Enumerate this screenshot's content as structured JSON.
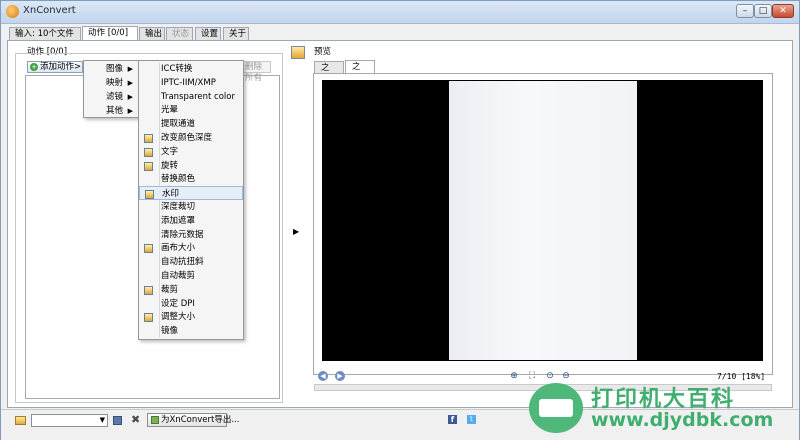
{
  "window": {
    "title": "XnConvert",
    "controls": {
      "minimize": "–",
      "maximize": "□",
      "close": "✕"
    }
  },
  "tabs": [
    {
      "label": "输入: 10个文件",
      "state": "normal"
    },
    {
      "label": "动作 [0/0]",
      "state": "active"
    },
    {
      "label": "输出",
      "state": "normal"
    },
    {
      "label": "状态",
      "state": "disabled"
    },
    {
      "label": "设置",
      "state": "normal"
    },
    {
      "label": "关于",
      "state": "normal"
    }
  ],
  "actions_panel": {
    "title": "动作 [0/0]",
    "add_button": "添加动作>",
    "delete_all_button": "删除所有"
  },
  "category_menu": {
    "items": [
      {
        "label": "图像",
        "has_submenu": true
      },
      {
        "label": "映射",
        "has_submenu": true
      },
      {
        "label": "滤镜",
        "has_submenu": true
      },
      {
        "label": "其他",
        "has_submenu": true
      }
    ]
  },
  "image_submenu": {
    "items": [
      {
        "label": "ICC转换",
        "icon": false
      },
      {
        "label": "IPTC-IIM/XMP",
        "icon": false
      },
      {
        "label": "Transparent color",
        "icon": false
      },
      {
        "label": "光晕",
        "icon": false
      },
      {
        "label": "提取通道",
        "icon": false
      },
      {
        "label": "改变颜色深度",
        "icon": true
      },
      {
        "label": "文字",
        "icon": true
      },
      {
        "label": "旋转",
        "icon": true
      },
      {
        "label": "替换颜色",
        "icon": false
      },
      {
        "label": "水印",
        "icon": true,
        "highlighted": true
      },
      {
        "label": "深度裁切",
        "icon": false
      },
      {
        "label": "添加遮罩",
        "icon": false
      },
      {
        "label": "清除元数据",
        "icon": false
      },
      {
        "label": "画布大小",
        "icon": true
      },
      {
        "label": "自动抗扭斜",
        "icon": false
      },
      {
        "label": "自动裁剪",
        "icon": false
      },
      {
        "label": "裁剪",
        "icon": true
      },
      {
        "label": "设定 DPI",
        "icon": false
      },
      {
        "label": "调整大小",
        "icon": true
      },
      {
        "label": "镜像",
        "icon": false
      }
    ]
  },
  "preview": {
    "title": "预览",
    "tabs": [
      {
        "label": "之前",
        "state": "normal"
      },
      {
        "label": "之后",
        "state": "active"
      }
    ],
    "page_count": "7/10 [18%]"
  },
  "bottom": {
    "export_button": "为XnConvert导出...",
    "facebook": "f",
    "twitter": "t"
  },
  "watermark": {
    "text": "打印机大百科",
    "url": "www.djydbk.com"
  }
}
